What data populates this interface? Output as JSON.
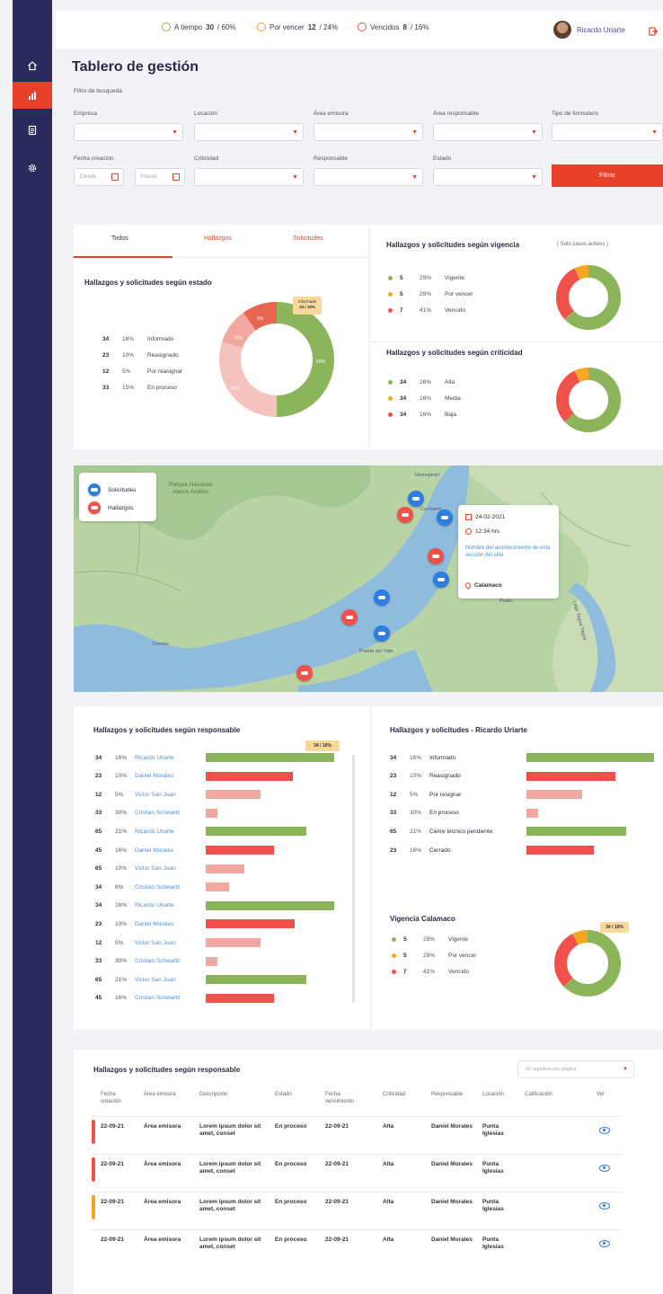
{
  "colors": {
    "accent": "#e8412a",
    "sidebar": "#2b2a5c",
    "green": "#8cb55b",
    "orange": "#f5a623",
    "red": "#f0514a",
    "pink": "#f2a7a0",
    "blue": "#2d7de3"
  },
  "topbar": {
    "stats": [
      {
        "label": "A tiempo",
        "value": "30",
        "pct": "/ 60%",
        "color": "#8cb55b"
      },
      {
        "label": "Por vencer",
        "value": "12",
        "pct": "/ 24%",
        "color": "#f5a623"
      },
      {
        "label": "Vencidos",
        "value": "8",
        "pct": "/ 16%",
        "color": "#f0514a"
      }
    ],
    "user_name": "Ricardo Uriarte"
  },
  "sidebar": {
    "items": [
      {
        "icon": "home-icon"
      },
      {
        "icon": "chart-icon"
      },
      {
        "icon": "document-icon"
      },
      {
        "icon": "settings-icon"
      }
    ]
  },
  "header": {
    "title": "Tablero de gestión",
    "filter_label": "Filtro de busqueda"
  },
  "filters": {
    "empresa": "Empresa",
    "locacion": "Locación",
    "area_emisora": "Área emisora",
    "area_responsable": "Área responsable",
    "tipo_formulario": "Tipo de formulario",
    "fecha_creacion": "Fecha creación",
    "desde": "Desde",
    "hasta": "Hasta",
    "criticidad": "Criticidad",
    "responsable": "Responsable",
    "estado": "Estado",
    "filtrar": "Filtrar"
  },
  "estado_card": {
    "tabs": [
      "Todos",
      "Hallazgos",
      "Solicitudes"
    ],
    "title": "Hallazgos y solicitudes según estado",
    "tooltip_label": "Informado",
    "tooltip_value": "34 / 16%",
    "rows": [
      {
        "n": "34",
        "p": "16%",
        "label": "Informado"
      },
      {
        "n": "23",
        "p": "10%",
        "label": "Reasignado"
      },
      {
        "n": "12",
        "p": "5%",
        "label": "Por reasignar"
      },
      {
        "n": "33",
        "p": "15%",
        "label": "En proceso"
      }
    ],
    "donut_labels": [
      "5%",
      "10%",
      "15%",
      "60%",
      "16%"
    ]
  },
  "vigencia_card": {
    "title": "Hallazgos y solicitudes según vigencia",
    "note": "( Solo casos activos )",
    "rows": [
      {
        "n": "5",
        "p": "29%",
        "label": "Vigente",
        "color": "#8cb55b"
      },
      {
        "n": "5",
        "p": "29%",
        "label": "Por vencer",
        "color": "#f5a623"
      },
      {
        "n": "7",
        "p": "41%",
        "label": "Vencido",
        "color": "#f0514a"
      }
    ]
  },
  "criticidad_card": {
    "title": "Hallazgos y solicitudes según criticidad",
    "rows": [
      {
        "n": "34",
        "p": "16%",
        "label": "Alta",
        "color": "#8cb55b"
      },
      {
        "n": "34",
        "p": "16%",
        "label": "Media",
        "color": "#f5a623"
      },
      {
        "n": "34",
        "p": "16%",
        "label": "Baja",
        "color": "#f0514a"
      }
    ]
  },
  "map": {
    "legend": [
      "Solicitudes",
      "Hallazgos"
    ],
    "park_label": "Parque Nacional Alerce Andino",
    "popup": {
      "date": "24-02-2021",
      "time": "12:34 hrs",
      "text": "Nombre del acontecimiento de esta sección del sitio",
      "place": "Calamaco"
    },
    "places": [
      "Puelo",
      "Cochamó",
      "Contao",
      "Hornopirén",
      "Lago Tagua Tagua",
      "Puerto del Yate"
    ]
  },
  "responsable_card": {
    "title": "Hallazgos y solicitudes según responsable",
    "tooltip": "34 / 16%",
    "rows": [
      {
        "n": "34",
        "p": "16%",
        "name": "Ricardo Uriarte",
        "v": 100,
        "c": "green"
      },
      {
        "n": "23",
        "p": "10%",
        "name": "Daniel Morales",
        "v": 68,
        "c": "red"
      },
      {
        "n": "12",
        "p": "5%",
        "name": "Victor San Juan",
        "v": 43,
        "c": "pink"
      },
      {
        "n": "33",
        "p": "30%",
        "name": "Cristian Schwartz",
        "v": 9,
        "c": "pink"
      },
      {
        "n": "65",
        "p": "21%",
        "name": "Ricardo Uriarte",
        "v": 78,
        "c": "green"
      },
      {
        "n": "45",
        "p": "16%",
        "name": "Daniel Morales",
        "v": 53,
        "c": "red"
      },
      {
        "n": "65",
        "p": "10%",
        "name": "Victor San Juan",
        "v": 30,
        "c": "pink"
      },
      {
        "n": "34",
        "p": "6%",
        "name": "Cristian Schwartz",
        "v": 18,
        "c": "pink"
      },
      {
        "n": "34",
        "p": "16%",
        "name": "Ricardo Uriarte",
        "v": 100,
        "c": "green"
      },
      {
        "n": "23",
        "p": "10%",
        "name": "Daniel Morales",
        "v": 69,
        "c": "red"
      },
      {
        "n": "12",
        "p": "5%",
        "name": "Victor San Juan",
        "v": 43,
        "c": "pink"
      },
      {
        "n": "33",
        "p": "30%",
        "name": "Cristian Schwartz",
        "v": 9,
        "c": "pink"
      },
      {
        "n": "65",
        "p": "21%",
        "name": "Victor San Juan",
        "v": 78,
        "c": "green"
      },
      {
        "n": "45",
        "p": "16%",
        "name": "Cristian Schwartz",
        "v": 53,
        "c": "red"
      }
    ]
  },
  "ricardo_card": {
    "title": "Hallazgos y solicitudes - Ricardo Uriarte",
    "rows": [
      {
        "n": "34",
        "p": "16%",
        "label": "Informado",
        "v": 100,
        "c": "green"
      },
      {
        "n": "23",
        "p": "10%",
        "label": "Reasignado",
        "v": 70,
        "c": "red"
      },
      {
        "n": "12",
        "p": "5%",
        "label": "Por resignar",
        "v": 44,
        "c": "pink"
      },
      {
        "n": "33",
        "p": "30%",
        "label": "En proceso",
        "v": 9,
        "c": "pink"
      },
      {
        "n": "65",
        "p": "21%",
        "label": "Cierre técnico pendiente",
        "v": 78,
        "c": "green"
      },
      {
        "n": "23",
        "p": "16%",
        "label": "Cerrado",
        "v": 53,
        "c": "red"
      }
    ]
  },
  "calamaco_card": {
    "title": "Vigencia Calamaco",
    "tooltip": "34 / 16%",
    "rows": [
      {
        "n": "5",
        "p": "29%",
        "label": "Vigente",
        "color": "#8cb55b"
      },
      {
        "n": "5",
        "p": "29%",
        "label": "Por vencer",
        "color": "#f5a623"
      },
      {
        "n": "7",
        "p": "41%",
        "label": "Vencido",
        "color": "#f0514a"
      }
    ]
  },
  "table": {
    "title": "Hallazgos y solicitudes según responsable",
    "page_size": "50 registros por página",
    "headers": [
      "Fecha creación",
      "Área emisora",
      "Descripción",
      "Estado",
      "Fecha vencimiento",
      "Criticidad",
      "Responsable",
      "Locación",
      "Calificación",
      "Ver"
    ],
    "rows": [
      {
        "fecha": "22-09-21",
        "area": "Área emisora",
        "desc": "Lorem ipsum dolor sit amet, conset",
        "estado": "En proceso",
        "venc": "22-09-21",
        "crit": "Alta",
        "resp": "Daniel Morales",
        "loc": "Punta Iglesias",
        "flag": "#f0514a"
      },
      {
        "fecha": "22-09-21",
        "area": "Área emisora",
        "desc": "Lorem ipsum dolor sit amet, conset",
        "estado": "En proceso",
        "venc": "22-09-21",
        "crit": "Alta",
        "resp": "Daniel Morales",
        "loc": "Punta Iglesias",
        "flag": "#f0514a"
      },
      {
        "fecha": "22-09-21",
        "area": "Área emisora",
        "desc": "Lorem ipsum dolor sit amet, conset",
        "estado": "En proceso",
        "venc": "22-09-21",
        "crit": "Alta",
        "resp": "Daniel Morales",
        "loc": "Punta Iglesias",
        "flag": "#f5a623"
      },
      {
        "fecha": "22-09-21",
        "area": "Área emisora",
        "desc": "Lorem ipsum dolor sit amet, conset",
        "estado": "En proceso",
        "venc": "22-09-21",
        "crit": "Alta",
        "resp": "Daniel Morales",
        "loc": "Punta Iglesias",
        "flag": ""
      }
    ]
  }
}
